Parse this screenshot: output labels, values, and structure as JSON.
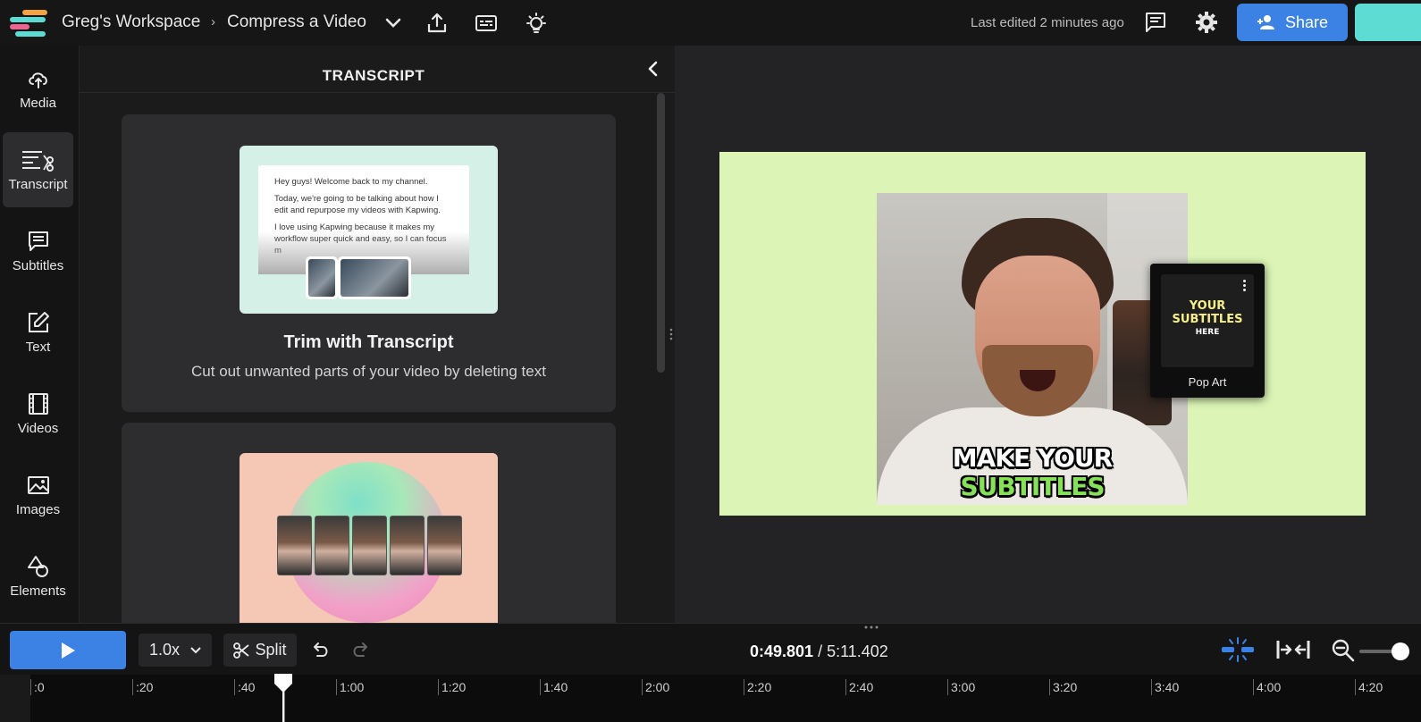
{
  "topbar": {
    "workspace": "Greg's Workspace",
    "separator": "›",
    "project": "Compress a Video",
    "last_edited": "Last edited 2 minutes ago",
    "share_label": "Share"
  },
  "rail": {
    "items": [
      {
        "label": "Media",
        "icon": "upload-cloud-icon"
      },
      {
        "label": "Transcript",
        "icon": "transcript-icon",
        "active": true
      },
      {
        "label": "Subtitles",
        "icon": "subtitles-icon"
      },
      {
        "label": "Text",
        "icon": "text-edit-icon"
      },
      {
        "label": "Videos",
        "icon": "film-icon"
      },
      {
        "label": "Images",
        "icon": "image-icon"
      },
      {
        "label": "Elements",
        "icon": "shapes-icon"
      }
    ]
  },
  "panel": {
    "title": "TRANSCRIPT",
    "card1": {
      "title": "Trim with Transcript",
      "description": "Cut out unwanted parts of your video by deleting text",
      "doc_lines": [
        "Hey guys! Welcome back to my channel.",
        "Today, we're going to be talking about how I edit and repurpose my videos with Kapwing.",
        "I love using Kapwing because it makes my workflow super quick and easy, so I can focus m"
      ]
    }
  },
  "preview": {
    "caption_line1": "MAKE YOUR",
    "caption_line2": "SUBTITLES",
    "style_popup": {
      "thumb_line1": "YOUR",
      "thumb_line2": "SUBTITLES",
      "thumb_line3": "HERE",
      "name": "Pop Art"
    },
    "colors": {
      "canvas_bg": "#dcf5b6",
      "caption_accent": "#86e05a"
    }
  },
  "timeline": {
    "speed": "1.0x",
    "split_label": "Split",
    "current_time": "0:49.801",
    "separator": " / ",
    "total_time": "5:11.402",
    "ticks": [
      ":0",
      ":20",
      ":40",
      "1:00",
      "1:20",
      "1:40",
      "2:00",
      "2:20",
      "2:40",
      "3:00",
      "3:20",
      "3:40",
      "4:00",
      "4:20"
    ]
  },
  "colors": {
    "accent": "#3b82e4",
    "teal": "#5ddcd3"
  }
}
